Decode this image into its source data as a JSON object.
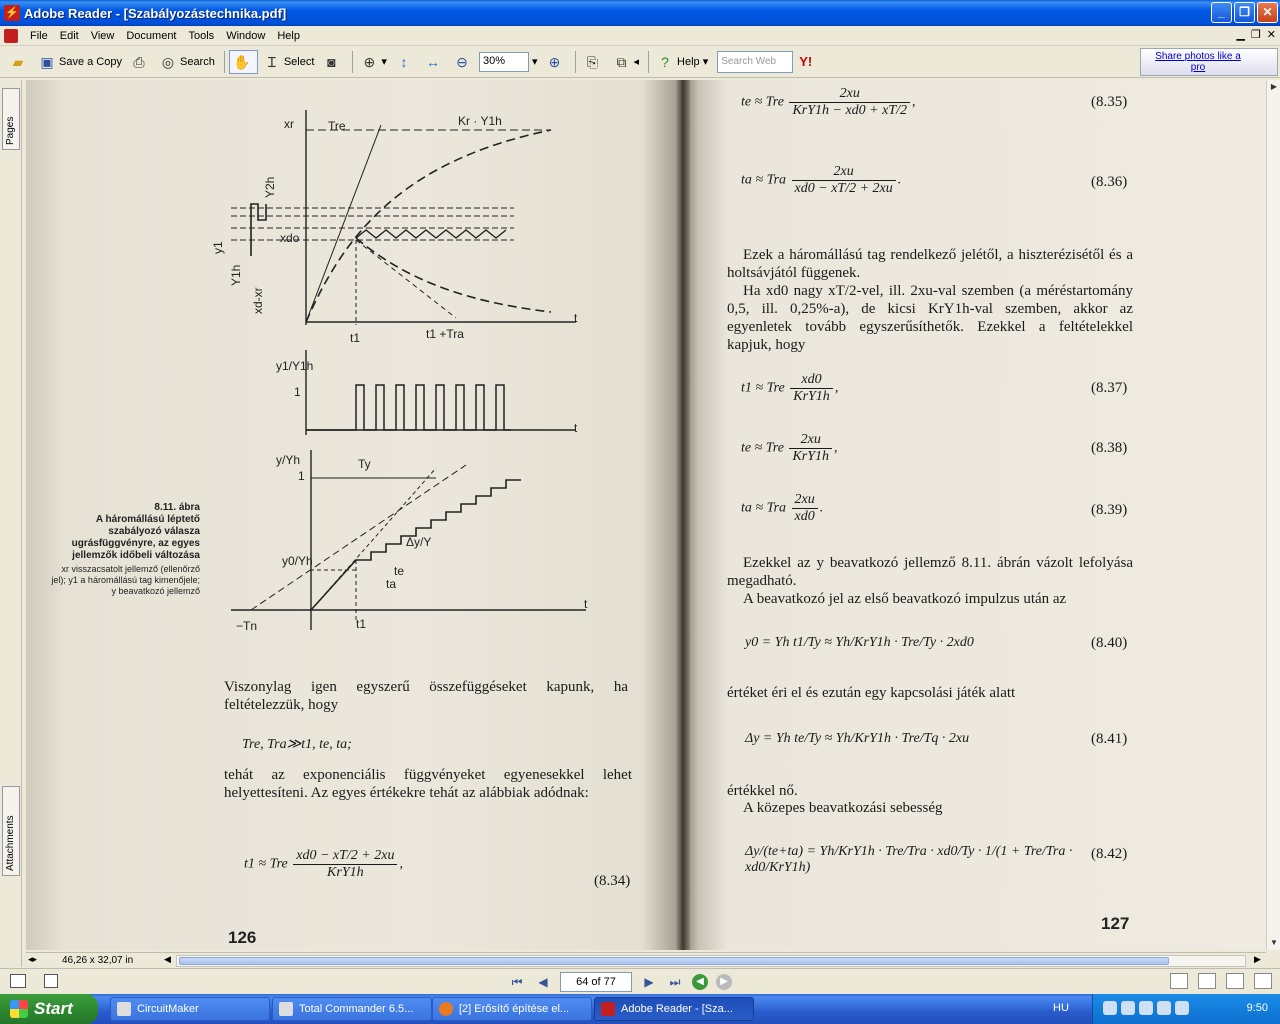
{
  "window": {
    "title": "Adobe Reader - [Szabályozástechnika.pdf]",
    "app_icon": "adobe-reader-icon",
    "buttons": [
      "minimize",
      "restore",
      "close"
    ]
  },
  "menu": {
    "items": [
      "File",
      "Edit",
      "View",
      "Document",
      "Tools",
      "Window",
      "Help"
    ]
  },
  "toolbar": {
    "save_copy": "Save a Copy",
    "search": "Search",
    "select": "Select",
    "zoom": "30%",
    "help": "Help",
    "search_placeholder": "Search Web",
    "yahoo": "Y!",
    "share": "Share photos like a pro"
  },
  "nav_tabs": {
    "pages": "Pages",
    "attachments": "Attachments"
  },
  "left_page": {
    "page_number": "126",
    "caption_title": "8.11. ábra\nA háromállású léptető szabályozó válasza ugrásfüggvényre, az egyes jellemzők időbeli változása",
    "caption_body": "xr visszacsatolt jellemző (ellenőrző jel); y1 a háromállású tag kimenőjele; y beavatkozó jellemző",
    "figure_labels": {
      "xr": "xr",
      "tre": "Tre",
      "kr_y1h": "Kr · Y1h",
      "y2h": "Y2h",
      "y1": "y1",
      "xdo": "xdo",
      "y1h": "Y1h",
      "xd_xr": "xd-xr",
      "t1": "t1",
      "t1_tra": "t1 +Tra",
      "t": "t",
      "y1_over_y1h": "y1/Y1h",
      "one": "1",
      "y_over_yh": "y/Yh",
      "ty": "Ty",
      "dy_over_y": "Δy/Y",
      "y0_over_yh": "y0/Yh",
      "te": "te",
      "ta": "ta",
      "minus_tn": "−Tn"
    },
    "para1": "Viszonylag igen egyszerű összefüggéseket kapunk, ha feltételezzük, hogy",
    "condition": "Tre, Tra≫t1, te, ta;",
    "para2": "tehát az exponenciális függvényeket egyenesekkel lehet helyettesíteni. Az egyes értékekre tehát az alábbiak adódnak:",
    "eq834": {
      "lhs": "t1 ≈ Tre",
      "num": "xd0 − xT/2 + 2xu",
      "den": "KrY1h",
      "number": "(8.34)"
    }
  },
  "right_page": {
    "page_number": "127",
    "eq835": {
      "lhs": "te ≈ Tre",
      "num": "2xu",
      "den": "KrY1h − xd0 + xT/2",
      "number": "(8.35)"
    },
    "eq836": {
      "lhs": "ta ≈ Tra",
      "num": "2xu",
      "den": "xd0 − xT/2 + 2xu",
      "number": "(8.36)"
    },
    "para1": "Ezek a háromállású tag rendelkező jelétől, a hiszterézisétől és a holtsávjától függenek.",
    "para2": "Ha xd0 nagy xT/2-vel, ill. 2xu-val szemben (a méréstartomány 0,5, ill. 0,25%-a), de kicsi KrY1h-val szemben, akkor az egyenletek tovább egyszerűsíthetők. Ezekkel a feltételekkel kapjuk, hogy",
    "eq837": {
      "lhs": "t1 ≈ Tre",
      "num": "xd0",
      "den": "KrY1h",
      "number": "(8.37)"
    },
    "eq838": {
      "lhs": "te ≈ Tre",
      "num": "2xu",
      "den": "KrY1h",
      "number": "(8.38)"
    },
    "eq839": {
      "lhs": "ta ≈ Tra",
      "num": "2xu",
      "den": "xd0",
      "number": "(8.39)"
    },
    "para3": "Ezekkel az y beavatkozó jellemző 8.11. ábrán vázolt lefolyása megadható.",
    "para4": "A beavatkozó jel az első beavatkozó impulzus után az",
    "eq840": {
      "text": "y0 = Yh t1/Ty ≈ Yh/KrY1h · Tre/Ty · 2xd0",
      "number": "(8.40)"
    },
    "para5": "értéket éri el és ezután egy kapcsolási játék alatt",
    "eq841": {
      "text": "Δy = Yh te/Ty ≈ Yh/KrY1h · Tre/Tq · 2xu",
      "number": "(8.41)"
    },
    "para6": "értékkel nő.",
    "para7": "A közepes beavatkozási sebesség",
    "eq842": {
      "text": "Δy/(te+ta) = Yh/KrY1h · Tre/Tra · xd0/Ty · 1/(1 + Tre/Tra · xd0/KrY1h)",
      "number": "(8.42)"
    }
  },
  "hbar": {
    "page_size": "46,26 x 32,07 in"
  },
  "status": {
    "page_field": "64 of 77"
  },
  "taskbar": {
    "start": "Start",
    "tasks": [
      "CircuitMaker",
      "Total Commander 6.5...",
      "[2] Erősítő építése el...",
      "Adobe Reader - [Sza..."
    ],
    "lang": "HU",
    "clock": "9:50"
  }
}
